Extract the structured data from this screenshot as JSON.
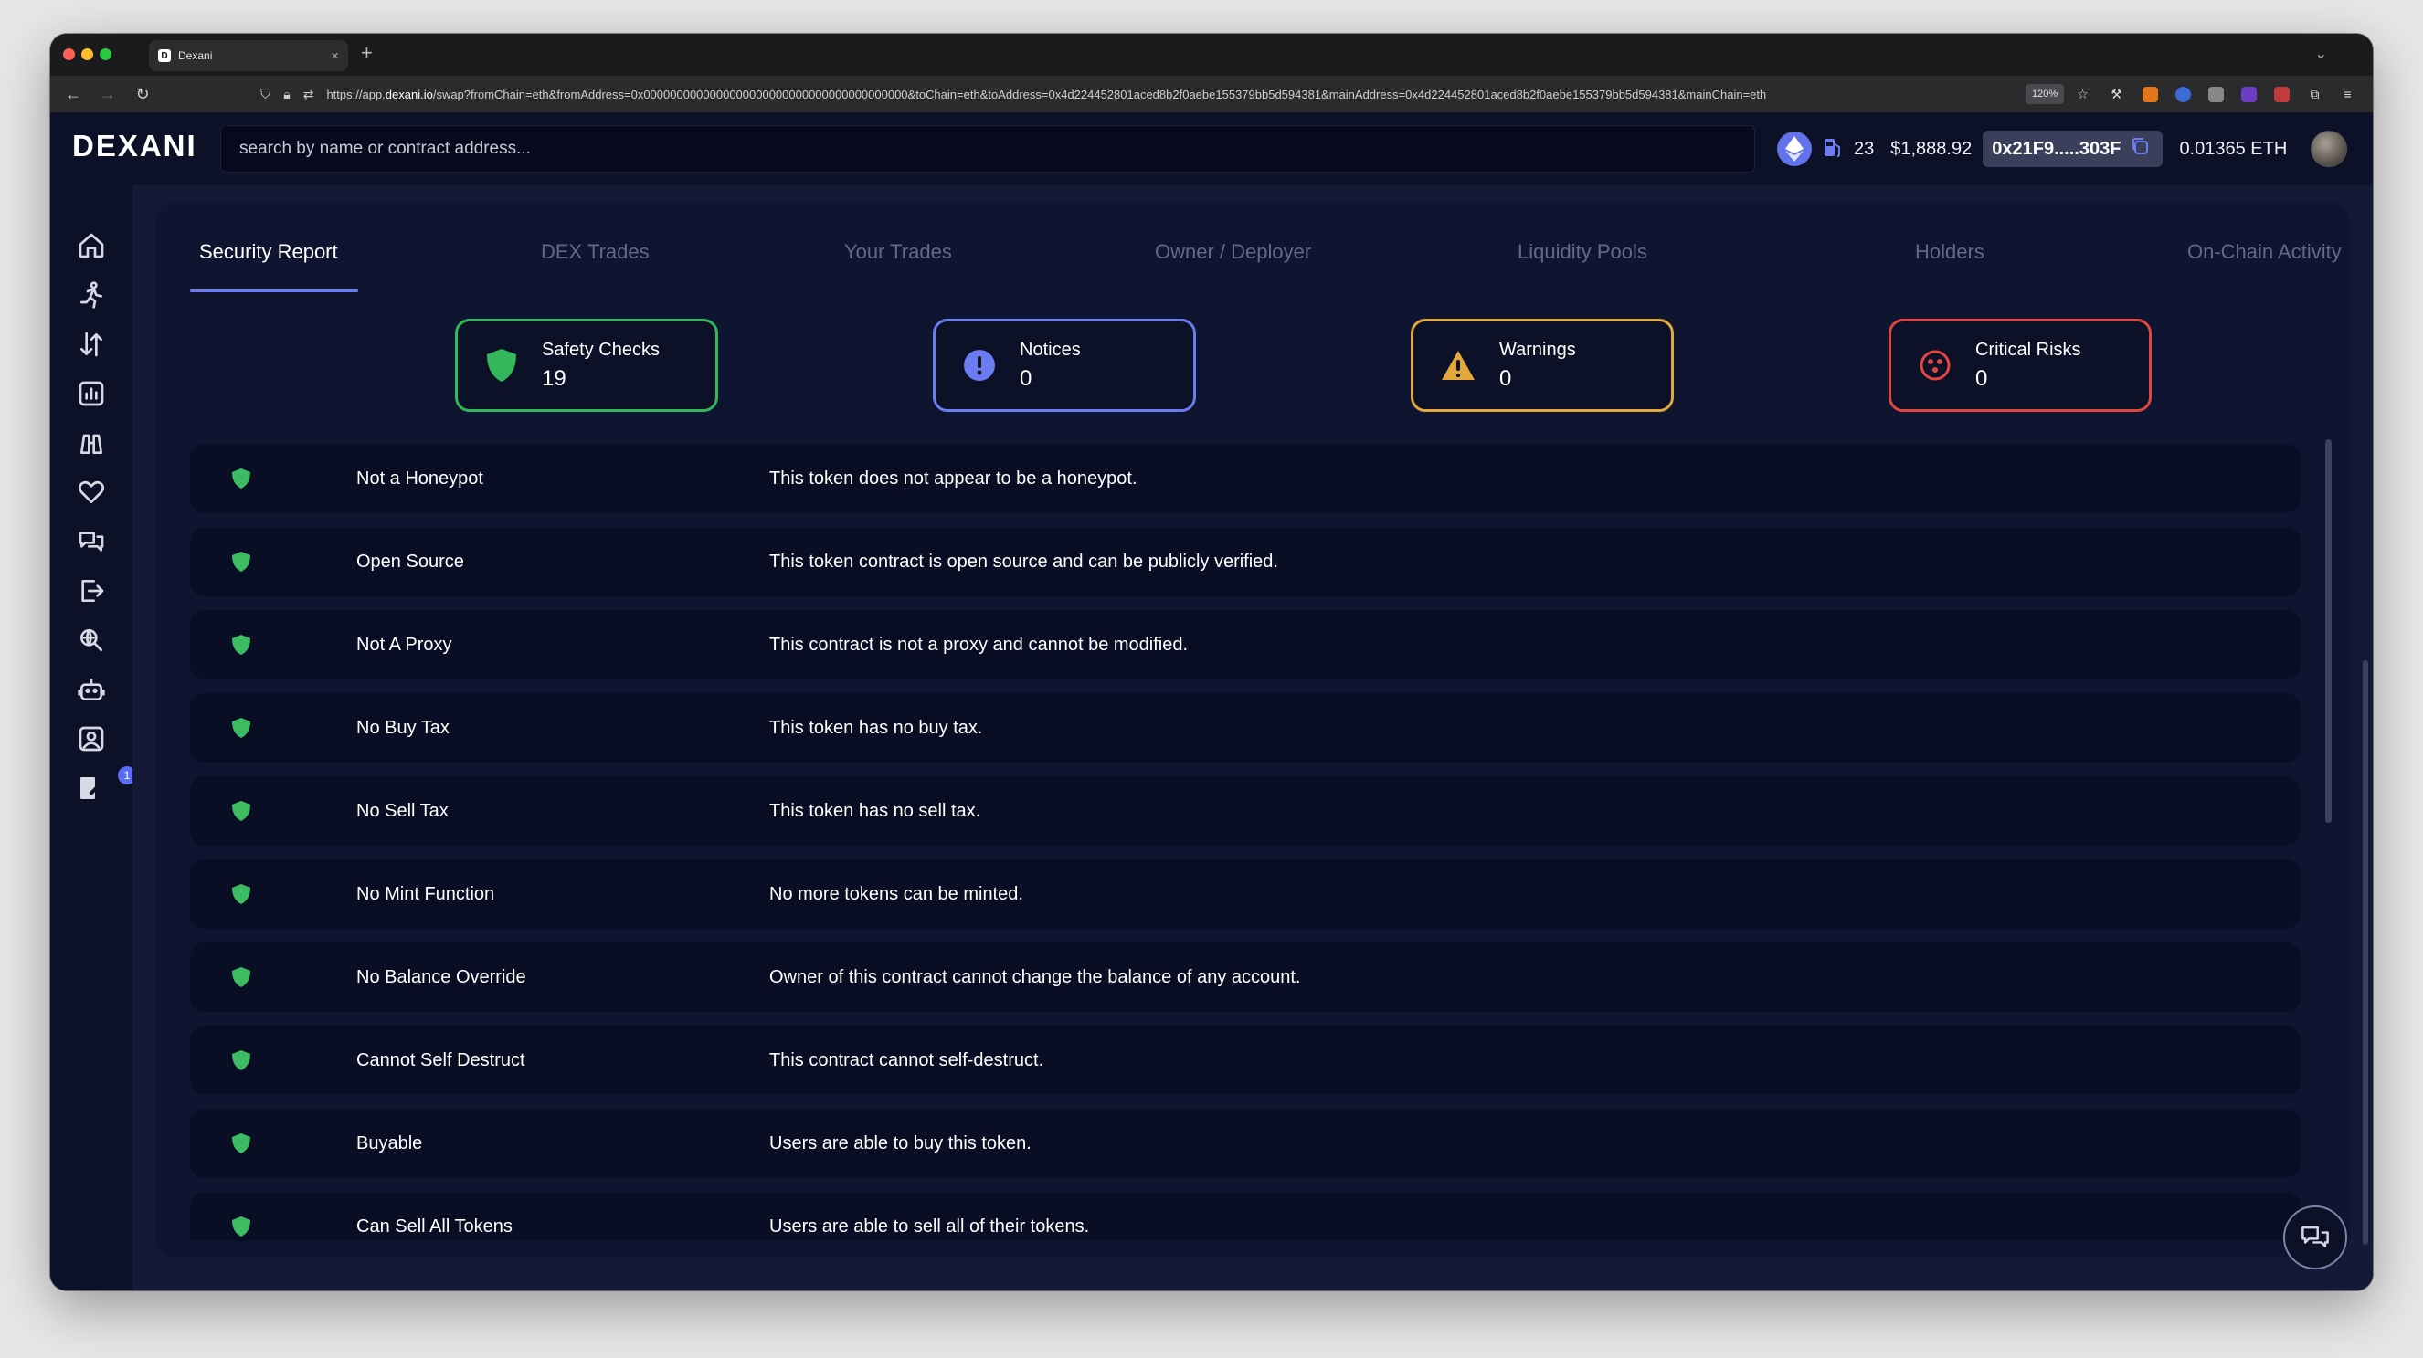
{
  "browser": {
    "tab_title": "Dexani",
    "tab_favicon": "D",
    "url_prefix": "https://app.",
    "url_domain": "dexani.io",
    "url_rest": "/swap?fromChain=eth&fromAddress=0x0000000000000000000000000000000000000000&toChain=eth&toAddress=0x4d224452801aced8b2f0aebe155379bb5d594381&mainAddress=0x4d224452801aced8b2f0aebe155379bb5d594381&mainChain=eth",
    "zoom": "120%"
  },
  "header": {
    "logo": "DEXANI",
    "search_placeholder": "search by name or contract address...",
    "gas": "23",
    "eth_price": "$1,888.92",
    "wallet_address": "0x21F9.....303F",
    "eth_balance": "0.01365 ETH"
  },
  "sidebar": {
    "icons": [
      "home-icon",
      "runner-icon",
      "swap-arrows-icon",
      "chart-icon",
      "binoculars-icon",
      "heart-icon",
      "chat-bubbles-icon",
      "logout-icon",
      "search-globe-icon",
      "robot-icon",
      "profile-icon",
      "edit-icon"
    ],
    "notification_badge": "1"
  },
  "tabs": [
    "Security Report",
    "DEX Trades",
    "Your Trades",
    "Owner / Deployer",
    "Liquidity Pools",
    "Holders",
    "On-Chain Activity"
  ],
  "summary": [
    {
      "label": "Safety Checks",
      "value": "19",
      "color": "#32b85a",
      "icon": "shield-icon"
    },
    {
      "label": "Notices",
      "value": "0",
      "color": "#6a7cf0",
      "icon": "info-icon"
    },
    {
      "label": "Warnings",
      "value": "0",
      "color": "#e4a73c",
      "icon": "warning-icon"
    },
    {
      "label": "Critical Risks",
      "value": "0",
      "color": "#e0473f",
      "icon": "critical-icon"
    }
  ],
  "checks": [
    {
      "name": "Not a Honeypot",
      "desc": "This token does not appear to be a honeypot."
    },
    {
      "name": "Open Source",
      "desc": "This token contract is open source and can be publicly verified."
    },
    {
      "name": "Not A Proxy",
      "desc": "This contract is not a proxy and cannot be modified."
    },
    {
      "name": "No Buy Tax",
      "desc": "This token has no buy tax."
    },
    {
      "name": "No Sell Tax",
      "desc": "This token has no sell tax."
    },
    {
      "name": "No Mint Function",
      "desc": "No more tokens can be minted."
    },
    {
      "name": "No Balance Override",
      "desc": "Owner of this contract cannot change the balance of any account."
    },
    {
      "name": "Cannot Self Destruct",
      "desc": "This contract cannot self-destruct."
    },
    {
      "name": "Buyable",
      "desc": "Users are able to buy this token."
    },
    {
      "name": "Can Sell All Tokens",
      "desc": "Users are able to sell all of their tokens."
    }
  ]
}
